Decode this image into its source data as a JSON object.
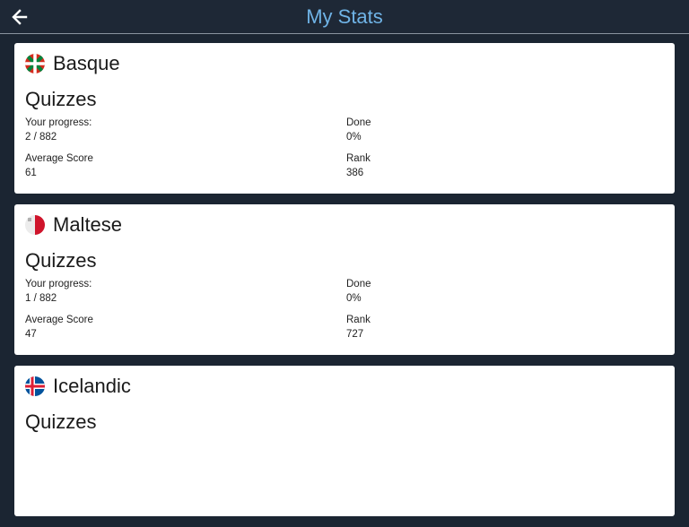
{
  "header": {
    "title": "My Stats",
    "back_icon": "arrow-left-icon"
  },
  "colors": {
    "background": "#1b2532",
    "title": "#6fb3e6",
    "card": "#ffffff"
  },
  "cards": [
    {
      "language": "Basque",
      "flag_icon": "basque-flag-icon",
      "section": "Quizzes",
      "progress_label": "Your progress:",
      "progress_value": "2 / 882",
      "done_label": "Done",
      "done_value": "0%",
      "avg_label": "Average Score",
      "avg_value": "61",
      "rank_label": "Rank",
      "rank_value": "386"
    },
    {
      "language": "Maltese",
      "flag_icon": "maltese-flag-icon",
      "section": "Quizzes",
      "progress_label": "Your progress:",
      "progress_value": "1 / 882",
      "done_label": "Done",
      "done_value": "0%",
      "avg_label": "Average Score",
      "avg_value": "47",
      "rank_label": "Rank",
      "rank_value": "727"
    },
    {
      "language": "Icelandic",
      "flag_icon": "icelandic-flag-icon",
      "section": "Quizzes"
    }
  ]
}
